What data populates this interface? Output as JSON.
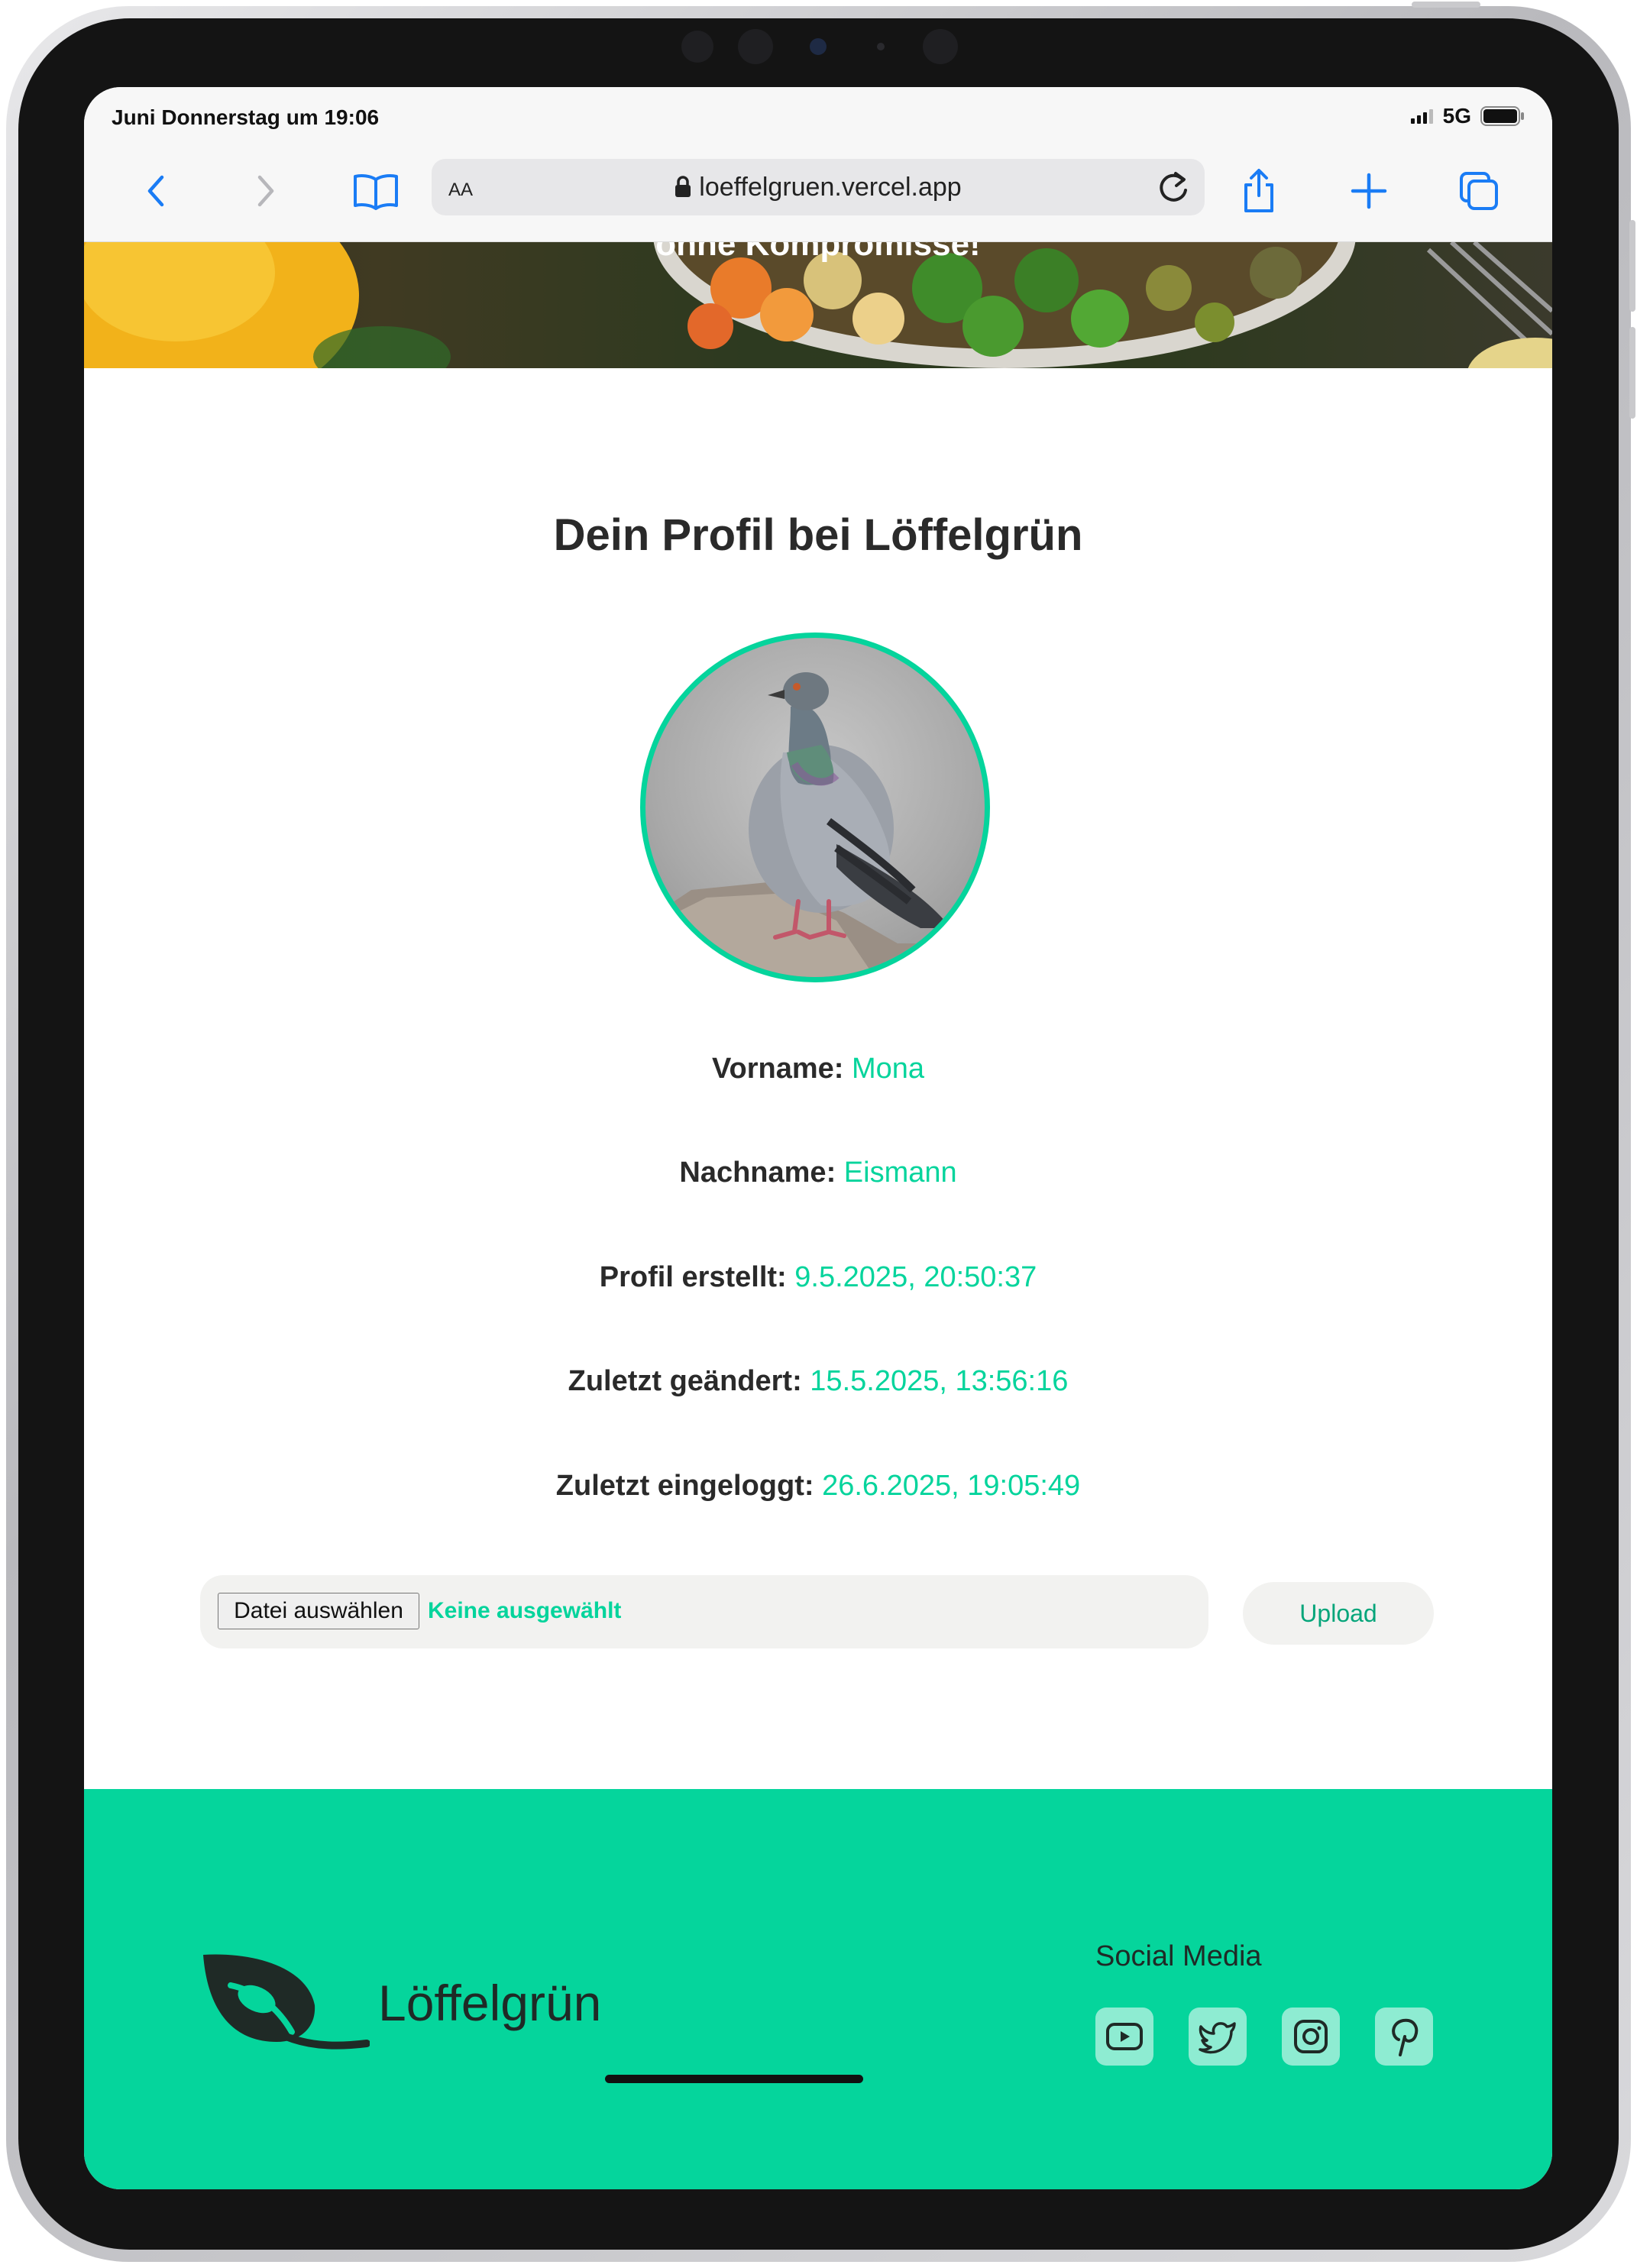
{
  "status": {
    "time": "Juni Donnerstag um 19:06",
    "network": "5G"
  },
  "browser": {
    "text_size_label": "AA",
    "url": "loeffelgruen.vercel.app"
  },
  "hero": {
    "text": "ohne Kompromisse!"
  },
  "profile": {
    "title": "Dein Profil bei Löffelgrün",
    "fields": [
      {
        "label": "Vorname:",
        "value": "Mona"
      },
      {
        "label": "Nachname:",
        "value": "Eismann"
      },
      {
        "label": "Profil erstellt:",
        "value": "9.5.2025, 20:50:37"
      },
      {
        "label": "Zuletzt geändert:",
        "value": "15.5.2025, 13:56:16"
      },
      {
        "label": "Zuletzt eingeloggt:",
        "value": "26.6.2025, 19:05:49"
      }
    ],
    "file_button_label": "Datei auswählen",
    "file_status": "Keine ausgewählt",
    "upload_label": "Upload"
  },
  "footer": {
    "brand_name": "Löffelgrün",
    "social_title": "Social Media",
    "social_icons": [
      "youtube-icon",
      "twitter-icon",
      "instagram-icon",
      "pinterest-icon"
    ]
  },
  "colors": {
    "accent": "#05d49c",
    "footer_bg": "#05d59c",
    "text_dark": "#2a2a2a",
    "ios_blue": "#1a7cf5"
  }
}
